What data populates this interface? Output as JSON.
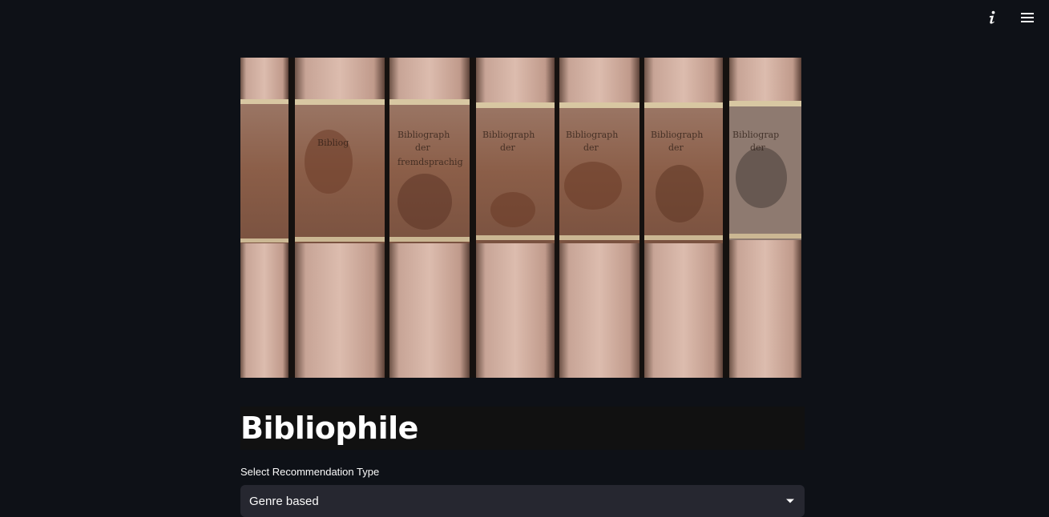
{
  "toolbar": {
    "info_icon": "info-icon",
    "menu_icon": "hamburger-menu-icon"
  },
  "hero": {
    "image_subject": "old-book-spines"
  },
  "page": {
    "title": "Bibliophile"
  },
  "recommendation": {
    "label": "Select Recommendation Type",
    "selected": "Genre based"
  },
  "colors": {
    "background": "#0e1117",
    "select_background": "#262730",
    "title_background": "#111111",
    "text": "#fafafa"
  }
}
